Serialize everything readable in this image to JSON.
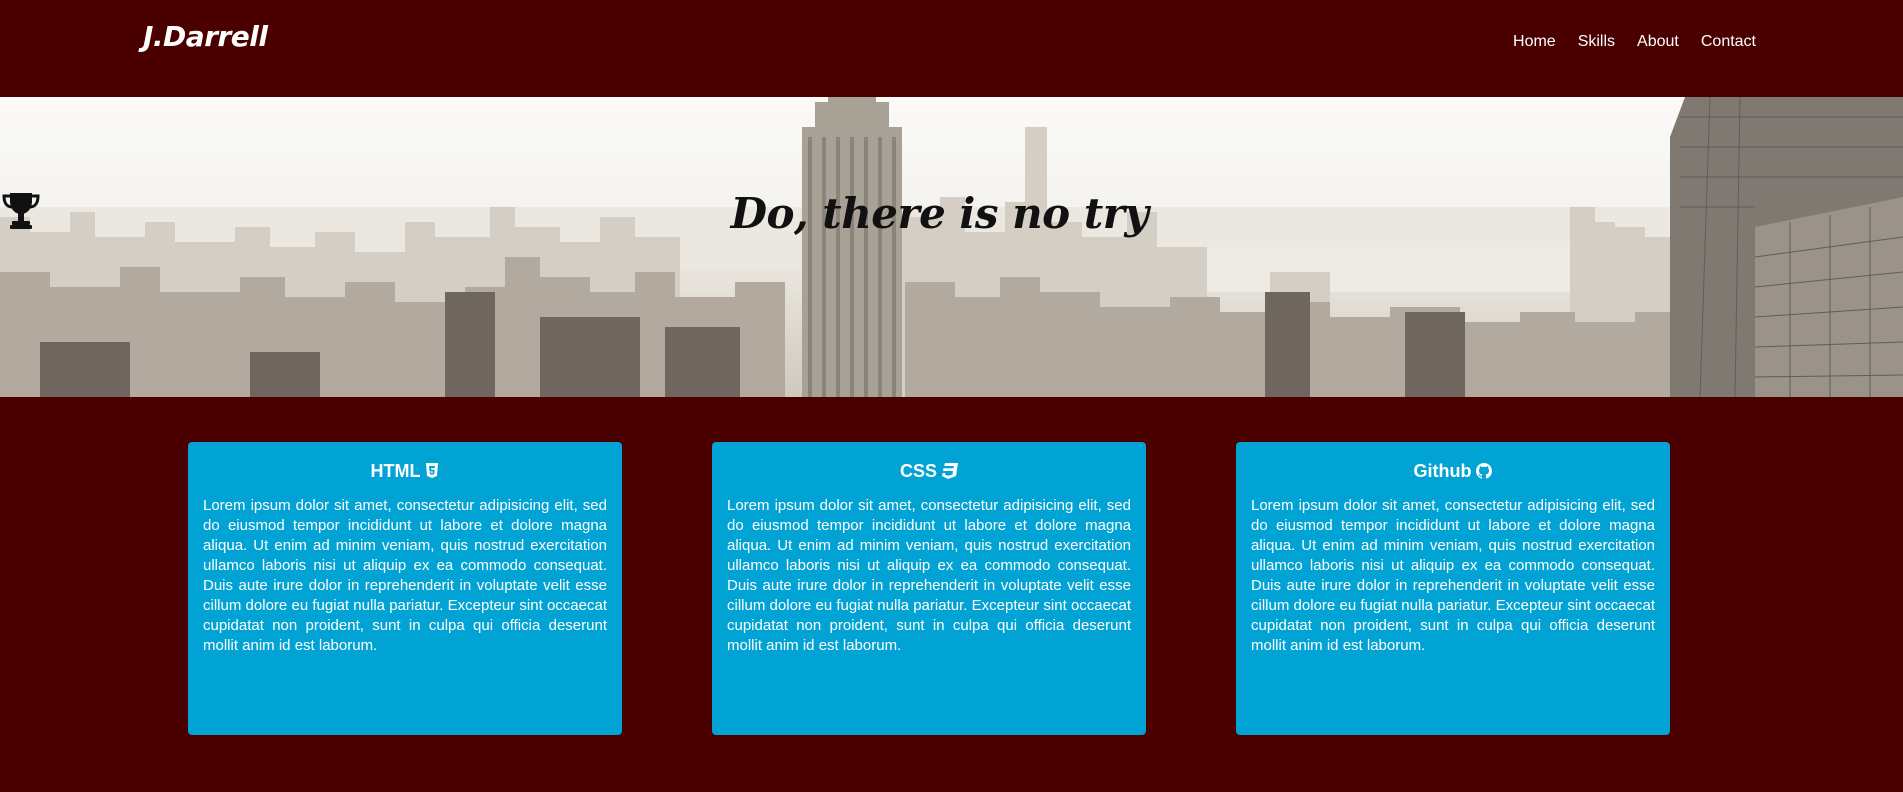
{
  "navbar": {
    "brand": "J.Darrell",
    "links": [
      "Home",
      "Skills",
      "About",
      "Contact"
    ]
  },
  "hero": {
    "title": "Do, there is no try",
    "icon": "trophy-icon"
  },
  "cards": [
    {
      "title": "HTML",
      "icon": "html5-icon",
      "text": "Lorem ipsum dolor sit amet, consectetur adipisicing elit, sed do eiusmod tempor incididunt ut labore et dolore magna aliqua. Ut enim ad minim veniam, quis nostrud exercitation ullamco laboris nisi ut aliquip ex ea commodo consequat. Duis aute irure dolor in reprehenderit in voluptate velit esse cillum dolore eu fugiat nulla pariatur. Excepteur sint occaecat cupidatat non proident, sunt in culpa qui officia deserunt mollit anim id est laborum."
    },
    {
      "title": "CSS",
      "icon": "css3-icon",
      "text": "Lorem ipsum dolor sit amet, consectetur adipisicing elit, sed do eiusmod tempor incididunt ut labore et dolore magna aliqua. Ut enim ad minim veniam, quis nostrud exercitation ullamco laboris nisi ut aliquip ex ea commodo consequat. Duis aute irure dolor in reprehenderit in voluptate velit esse cillum dolore eu fugiat nulla pariatur. Excepteur sint occaecat cupidatat non proident, sunt in culpa qui officia deserunt mollit anim id est laborum."
    },
    {
      "title": "Github",
      "icon": "github-icon",
      "text": "Lorem ipsum dolor sit amet, consectetur adipisicing elit, sed do eiusmod tempor incididunt ut labore et dolore magna aliqua. Ut enim ad minim veniam, quis nostrud exercitation ullamco laboris nisi ut aliquip ex ea commodo consequat. Duis aute irure dolor in reprehenderit in voluptate velit esse cillum dolore eu fugiat nulla pariatur. Excepteur sint occaecat cupidatat non proident, sunt in culpa qui officia deserunt mollit anim id est laborum."
    }
  ],
  "colors": {
    "background": "#4b0000",
    "card": "#00a3d3",
    "text": "#ffffff",
    "hero_text": "#111111"
  }
}
